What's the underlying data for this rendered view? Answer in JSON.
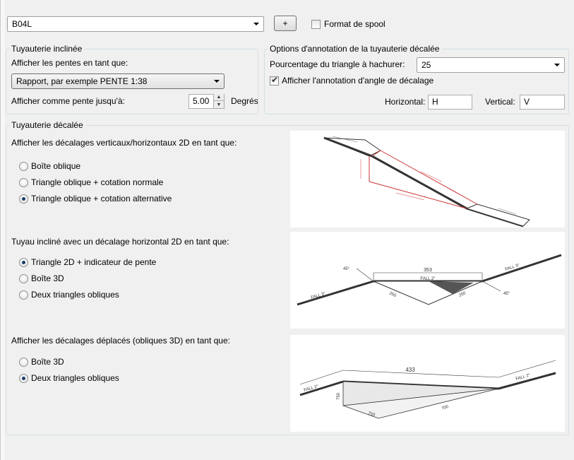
{
  "top": {
    "style_value": "B04L",
    "add_button": "+",
    "spool_format_label": "Format de spool",
    "spool_format_checked": false
  },
  "sloped": {
    "title": "Tuyauterie inclinée",
    "display_slopes_label": "Afficher les pentes en tant que:",
    "display_slopes_value": "Rapport, par exemple PENTE 1:38",
    "display_as_slope_label": "Afficher comme pente jusqu'à:",
    "slope_value": "5.00",
    "degrees_label": "Degrés"
  },
  "annotation": {
    "title": "Options d'annotation de la tuyauterie décalée",
    "hatch_percent_label": "Pourcentage du triangle à hachurer:",
    "hatch_percent_value": "25",
    "show_angle_label": "Afficher l'annotation d'angle de décalage",
    "show_angle_checked": true,
    "horizontal_label": "Horizontal:",
    "horizontal_value": "H",
    "vertical_label": "Vertical:",
    "vertical_value": "V"
  },
  "offset": {
    "title": "Tuyauterie décalée",
    "section1_label": "Afficher les décalages verticaux/horizontaux 2D en tant que:",
    "section1_options": [
      "Boîte oblique",
      "Triangle oblique + cotation normale",
      "Triangle oblique + cotation alternative"
    ],
    "section1_selected": 2,
    "section2_label": "Tuyau incliné avec un décalage horizontal 2D en tant que:",
    "section2_options": [
      "Triangle 2D + indicateur de pente",
      "Boîte 3D",
      "Deux triangles obliques"
    ],
    "section2_selected": 0,
    "section3_label": "Afficher les décalages déplacés (obliques 3D) en tant que:",
    "section3_options": [
      "Boîte 3D",
      "Deux triangles obliques"
    ],
    "section3_selected": 1
  },
  "previews": {
    "p2": {
      "top_dim": "353",
      "fall_mid": "FALL 2°",
      "fall_left": "FALL 3°",
      "fall_right": "FALL 3°",
      "angle_left": "45°",
      "angle_right": "45°",
      "dim_a": "250",
      "dim_b": "250"
    },
    "p3": {
      "top_dim": "433",
      "fall_left": "FALL 2°",
      "fall_right": "FALL 2°",
      "dim_v": "750",
      "dim_a": "750",
      "dim_b": "700"
    }
  }
}
